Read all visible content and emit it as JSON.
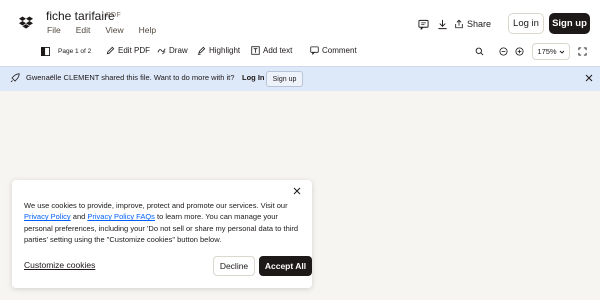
{
  "file": {
    "title": "fiche tarifaire",
    "type": "PDF"
  },
  "menu": [
    "File",
    "Edit",
    "View",
    "Help"
  ],
  "header": {
    "share_label": "Share",
    "login_label": "Log in",
    "signup_label": "Sign up"
  },
  "toolbar": {
    "page_count": "Page 1 of 2",
    "edit_pdf": "Edit PDF",
    "draw": "Draw",
    "highlight": "Highlight",
    "add_text": "Add text",
    "comment": "Comment",
    "zoom": "175%"
  },
  "banner": {
    "message": "Gwenaëlle CLEMENT shared this file. Want to do more with it?",
    "login_label": "Log In",
    "signup_label": "Sign up"
  },
  "cookie": {
    "text_1": "We use cookies to provide, improve, protect and promote our services. Visit our",
    "link_privacy": "Privacy Policy",
    "text_and": "and",
    "link_faqs": "Privacy Policy FAQs",
    "text_2": "to learn more. You can manage your personal preferences, including your 'Do not sell or share my personal data to third parties' setting using the \"Customize cookies\" button below.",
    "customize_label": "Customize cookies",
    "decline_label": "Decline",
    "accept_label": "Accept All"
  },
  "colors": {
    "primary_dark": "#1e1919",
    "banner_bg": "#dde8f9",
    "link": "#0061fe",
    "canvas_bg": "#f7f5f2"
  },
  "icons": [
    "dropbox-logo",
    "comment-icon",
    "download-icon",
    "share-icon",
    "sidebar-toggle-icon",
    "pencil-icon",
    "draw-icon",
    "highlighter-icon",
    "text-box-icon",
    "comment-icon",
    "search-icon",
    "zoom-out-icon",
    "zoom-in-icon",
    "chevron-down-icon",
    "fullscreen-icon",
    "rocket-icon",
    "close-icon"
  ]
}
